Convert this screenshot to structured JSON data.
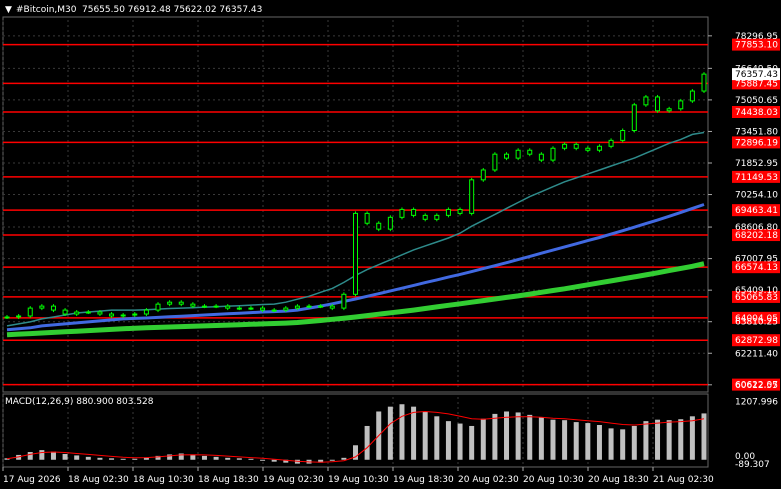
{
  "header": {
    "symbol": "#Bitcoin,M30",
    "ohlc": "75655.50 76912.48 75622.02 76357.43"
  },
  "macd_header": {
    "label": "MACD(12,26,9) 880.900 803.528"
  },
  "colors": {
    "background": "#000000",
    "grid": "#3a3a3a",
    "candle": "#00ff00",
    "level": "#ff0000",
    "ma_teal": "#2e8b8b",
    "ma_blue": "#4169e1",
    "ma_green": "#32cd32",
    "histogram": "#c0c0c0",
    "signal": "#ff0000",
    "current_price_bg": "#ffffff"
  },
  "chart_data": {
    "type": "line",
    "title": "#Bitcoin,M30",
    "price_axis": {
      "ylim": [
        60400,
        79100
      ],
      "ticks": [
        "78296.95",
        "76649.50",
        "75050.65",
        "73451.80",
        "71852.95",
        "70254.10",
        "68606.80",
        "67007.95",
        "65409.10",
        "63810.25",
        "62211.40",
        "60612.55"
      ]
    },
    "current_price": "76357.43",
    "levels": [
      "77853.10",
      "75887.45",
      "74438.03",
      "72896.19",
      "71149.53",
      "69463.41",
      "68202.18",
      "66574.13",
      "65065.83",
      "64004.05",
      "62872.98",
      "60622.07"
    ],
    "x_axis_labels": [
      "17 Aug 2026",
      "18 Aug 02:30",
      "18 Aug 10:30",
      "18 Aug 18:30",
      "19 Aug 02:30",
      "19 Aug 10:30",
      "19 Aug 18:30",
      "20 Aug 02:30",
      "20 Aug 10:30",
      "20 Aug 18:30",
      "21 Aug 02:30"
    ],
    "series": [
      {
        "name": "price",
        "values": [
          64050,
          64100,
          64500,
          64600,
          64400,
          64200,
          64300,
          64300,
          64200,
          64100,
          64150,
          64200,
          64400,
          64700,
          64800,
          64700,
          64600,
          64600,
          64600,
          64500,
          64500,
          64500,
          64400,
          64400,
          64500,
          64600,
          64600,
          64600,
          64500,
          65200,
          69300,
          68800,
          68500,
          69100,
          69500,
          69200,
          69000,
          69200,
          69500,
          69300,
          71000,
          71500,
          72300,
          72100,
          72500,
          72300,
          72000,
          72600,
          72800,
          72600,
          72500,
          72700,
          73000,
          73500,
          74800,
          75200,
          74500,
          74600,
          75000,
          75500,
          76357
        ]
      },
      {
        "values": [
          63600,
          63700,
          63800,
          63950,
          64050,
          64150,
          64250,
          64300,
          64350,
          64400,
          64400,
          64400,
          64420,
          64450,
          64480,
          64500,
          64520,
          64550,
          64570,
          64600,
          64620,
          64650,
          64680,
          64700,
          64800,
          64950,
          65100,
          65300,
          65500,
          65800,
          66150,
          66450,
          66700,
          66950,
          67200,
          67450,
          67650,
          67850,
          68050,
          68300,
          68650,
          68950,
          69250,
          69550,
          69850,
          70150,
          70400,
          70650,
          70900,
          71100,
          71300,
          71500,
          71700,
          71900,
          72100,
          72350,
          72600,
          72850,
          73050,
          73300,
          73400
        ]
      },
      {
        "values": [
          63400,
          63450,
          63500,
          63600,
          63650,
          63700,
          63750,
          63800,
          63850,
          63900,
          63950,
          63980,
          64000,
          64030,
          64060,
          64090,
          64120,
          64150,
          64180,
          64210,
          64240,
          64270,
          64300,
          64320,
          64350,
          64400,
          64500,
          64600,
          64720,
          64840,
          64960,
          65100,
          65230,
          65370,
          65510,
          65650,
          65790,
          65930,
          66070,
          66210,
          66350,
          66500,
          66650,
          66800,
          66960,
          67120,
          67280,
          67440,
          67600,
          67760,
          67920,
          68080,
          68250,
          68420,
          68600,
          68780,
          68960,
          69150,
          69350,
          69550,
          69750
        ]
      },
      {
        "values": [
          63150,
          63180,
          63210,
          63240,
          63270,
          63300,
          63330,
          63360,
          63390,
          63420,
          63450,
          63480,
          63500,
          63520,
          63540,
          63560,
          63580,
          63600,
          63620,
          63640,
          63660,
          63680,
          63700,
          63720,
          63740,
          63770,
          63820,
          63870,
          63930,
          63990,
          64050,
          64120,
          64190,
          64260,
          64330,
          64400,
          64480,
          64560,
          64640,
          64720,
          64800,
          64880,
          64960,
          65040,
          65120,
          65210,
          65300,
          65390,
          65480,
          65580,
          65680,
          65780,
          65880,
          65980,
          66080,
          66180,
          66290,
          66400,
          66510,
          66620,
          66750
        ]
      }
    ],
    "macd": {
      "title": "MACD(12,26,9) 880.900 803.528",
      "ticks": [
        "1207.996",
        "0.00",
        "-89.307"
      ],
      "ylim": [
        -150,
        1300
      ],
      "histogram": [
        30,
        100,
        160,
        200,
        170,
        120,
        90,
        60,
        40,
        30,
        20,
        20,
        50,
        80,
        110,
        130,
        110,
        80,
        60,
        40,
        30,
        20,
        0,
        -40,
        -60,
        -80,
        -80,
        -60,
        -20,
        40,
        300,
        700,
        1000,
        1100,
        1150,
        1100,
        1000,
        900,
        800,
        750,
        700,
        850,
        950,
        1000,
        980,
        930,
        880,
        830,
        820,
        780,
        760,
        720,
        650,
        630,
        700,
        800,
        830,
        820,
        840,
        900,
        960
      ],
      "signal": [
        20,
        60,
        110,
        150,
        160,
        150,
        130,
        110,
        90,
        70,
        50,
        40,
        45,
        60,
        80,
        100,
        105,
        100,
        90,
        75,
        60,
        45,
        30,
        10,
        -10,
        -30,
        -45,
        -50,
        -40,
        -20,
        60,
        250,
        500,
        750,
        900,
        980,
        1000,
        980,
        950,
        900,
        850,
        840,
        860,
        880,
        890,
        890,
        880,
        860,
        850,
        830,
        810,
        790,
        760,
        730,
        720,
        740,
        760,
        780,
        790,
        810,
        850
      ]
    }
  }
}
